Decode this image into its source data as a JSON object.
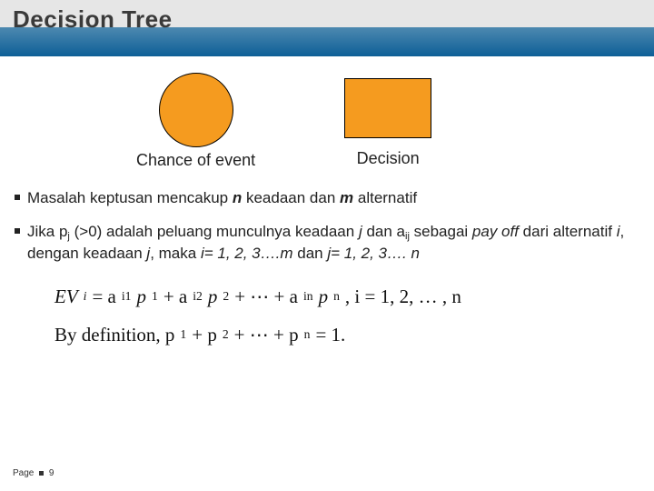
{
  "title": "Decision Tree",
  "shapes": {
    "chance_label": "Chance of event",
    "decision_label": "Decision"
  },
  "bullets": {
    "b1_pre": "Masalah keptusan mencakup ",
    "b1_n": "n",
    "b1_mid": " keadaan dan ",
    "b1_m": "m",
    "b1_post": " alternatif",
    "b2_pre": " Jika p",
    "b2_j": "j",
    "b2_gt": " (>0) adalah peluang munculnya keadaan ",
    "b2_j2": "j",
    "b2_dan": " dan a",
    "b2_ij": "ij",
    "b2_seb": " sebagai ",
    "b2_payoff": "pay off",
    "b2_dari": " dari alternatif ",
    "b2_i": "i",
    "b2_deng": ", dengan keadaan ",
    "b2_j3": "j",
    "b2_maka": ", maka ",
    "b2_irange": "i= 1, 2, 3….m",
    "b2_danj": " dan ",
    "b2_jrange": "j= 1, 2, 3…. n"
  },
  "formula": {
    "lhs": "EV",
    "lhs_sub": "i",
    "eq": " = a",
    "i1": "i1",
    "p": "p",
    "s1": "1",
    "plus": " + a",
    "i2": "i2",
    "s2": "2",
    "dots": " + ⋯ + a",
    "in": "in",
    "sn": "n",
    "tail": ", i = 1, 2, … , n",
    "bydef": "By definition, p",
    "d1": "1",
    "dplus": " + p",
    "d2": "2",
    "ddots": " + ⋯ + p",
    "dn": "n",
    "deq": " = 1."
  },
  "footer": {
    "page_label": "Page",
    "page_num": "9"
  }
}
